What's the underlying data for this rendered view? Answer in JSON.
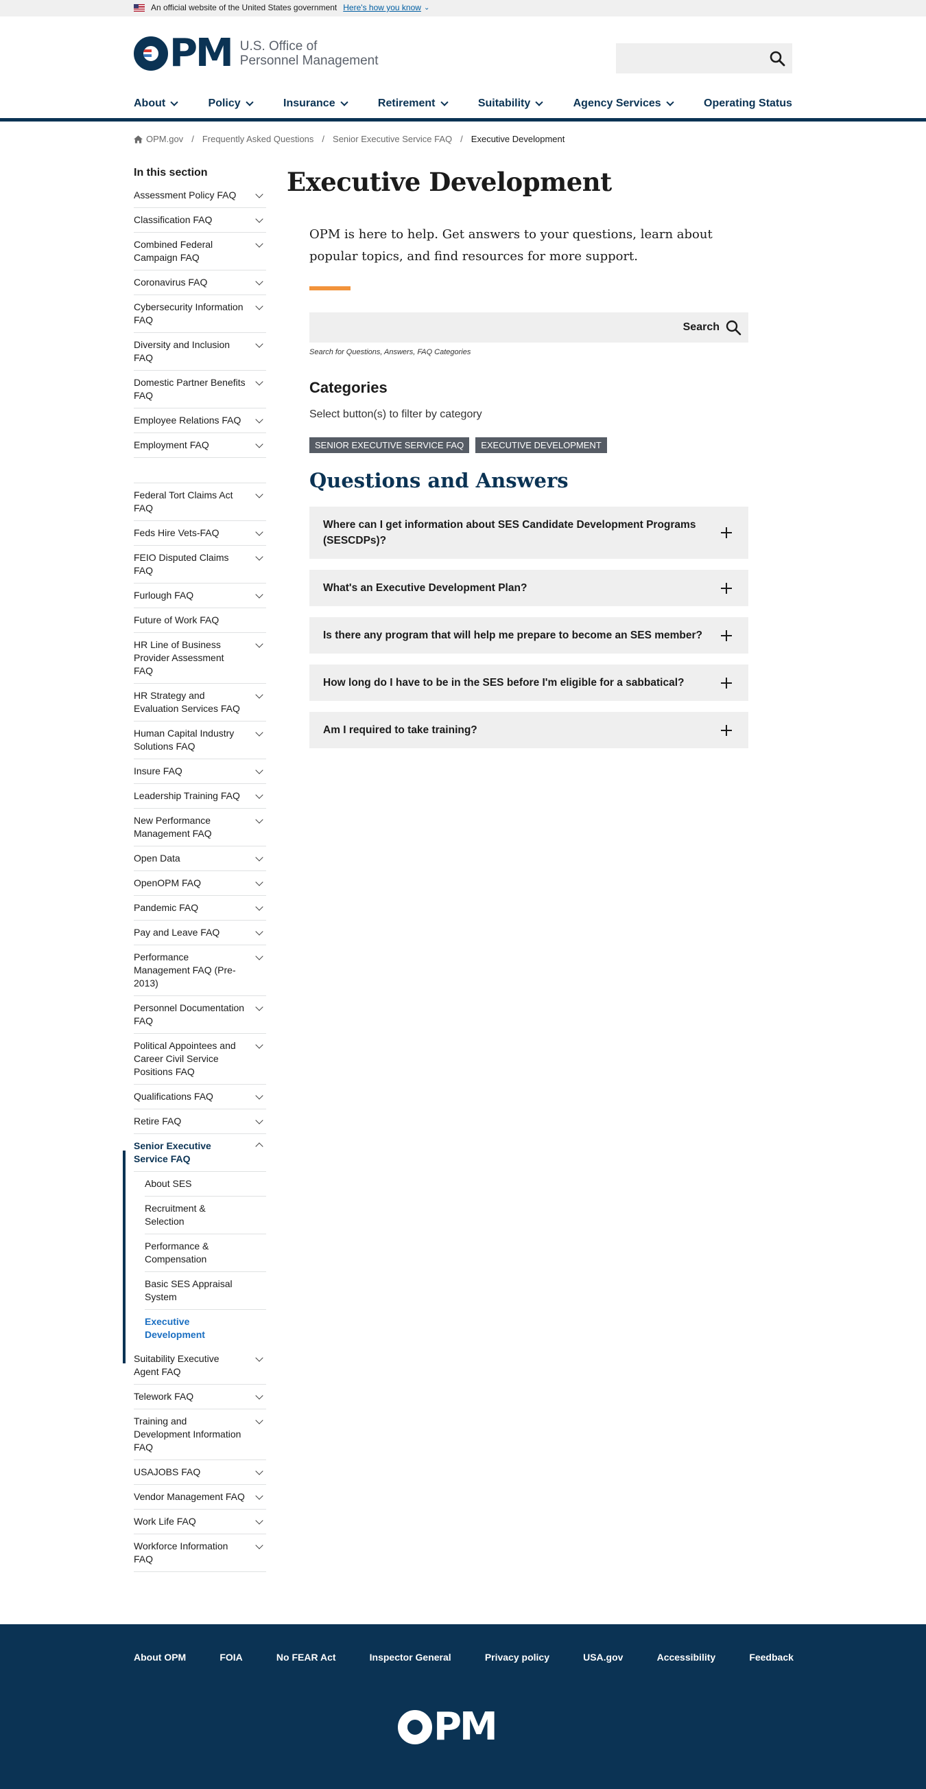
{
  "gov_banner": {
    "text": "An official website of the United States government",
    "link": "Here's how you know"
  },
  "header": {
    "logo_letters": "PM",
    "logo_line1": "U.S. Office of",
    "logo_line2": "Personnel Management",
    "search_placeholder": ""
  },
  "nav": [
    {
      "label": "About",
      "has_menu": true
    },
    {
      "label": "Policy",
      "has_menu": true
    },
    {
      "label": "Insurance",
      "has_menu": true
    },
    {
      "label": "Retirement",
      "has_menu": true
    },
    {
      "label": "Suitability",
      "has_menu": true
    },
    {
      "label": "Agency Services",
      "has_menu": true
    },
    {
      "label": "Operating Status",
      "has_menu": false
    }
  ],
  "breadcrumb": [
    "OPM.gov",
    "Frequently Asked Questions",
    "Senior Executive Service FAQ",
    "Executive Development"
  ],
  "sidebar": {
    "title": "In this section",
    "items": [
      {
        "label": "Assessment Policy FAQ",
        "caret": true
      },
      {
        "label": "Classification FAQ",
        "caret": true
      },
      {
        "label": "Combined Federal Campaign FAQ",
        "caret": true
      },
      {
        "label": "Coronavirus FAQ",
        "caret": true
      },
      {
        "label": "Cybersecurity Information FAQ",
        "caret": true
      },
      {
        "label": "Diversity and Inclusion FAQ",
        "caret": true
      },
      {
        "label": "Domestic Partner Benefits FAQ",
        "caret": true
      },
      {
        "label": "Employee Relations FAQ",
        "caret": true
      },
      {
        "label": "Employment FAQ",
        "caret": true
      },
      {
        "label": "",
        "caret": false
      },
      {
        "label": "Federal Tort Claims Act FAQ",
        "caret": true
      },
      {
        "label": "Feds Hire Vets-FAQ",
        "caret": true
      },
      {
        "label": "FEIO Disputed Claims FAQ",
        "caret": true
      },
      {
        "label": "Furlough FAQ",
        "caret": true
      },
      {
        "label": "Future of Work FAQ",
        "caret": false
      },
      {
        "label": "HR Line of Business Provider Assessment FAQ",
        "caret": true
      },
      {
        "label": "HR Strategy and Evaluation Services FAQ",
        "caret": true
      },
      {
        "label": "Human Capital Industry Solutions FAQ",
        "caret": true
      },
      {
        "label": "Insure FAQ",
        "caret": true
      },
      {
        "label": "Leadership Training FAQ",
        "caret": true
      },
      {
        "label": "New Performance Management FAQ",
        "caret": true
      },
      {
        "label": "Open Data",
        "caret": true
      },
      {
        "label": "OpenOPM FAQ",
        "caret": true
      },
      {
        "label": "Pandemic FAQ",
        "caret": true
      },
      {
        "label": "Pay and Leave FAQ",
        "caret": true
      },
      {
        "label": "Performance Management FAQ (Pre-2013)",
        "caret": true
      },
      {
        "label": "Personnel Documentation FAQ",
        "caret": true
      },
      {
        "label": "Political Appointees and Career Civil Service Positions FAQ",
        "caret": true
      },
      {
        "label": "Qualifications FAQ",
        "caret": true
      },
      {
        "label": "Retire FAQ",
        "caret": true
      },
      {
        "label": "Senior Executive Service FAQ",
        "caret": true,
        "open": true,
        "children": [
          "About SES",
          "Recruitment & Selection",
          "Performance & Compensation",
          "Basic SES Appraisal System",
          "Executive Development"
        ]
      },
      {
        "label": "Suitability Executive Agent FAQ",
        "caret": true
      },
      {
        "label": "Telework FAQ",
        "caret": true
      },
      {
        "label": "Training and Development Information FAQ",
        "caret": true
      },
      {
        "label": "USAJOBS FAQ",
        "caret": true
      },
      {
        "label": "Vendor Management FAQ",
        "caret": true
      },
      {
        "label": "Work Life FAQ",
        "caret": true
      },
      {
        "label": "Workforce Information FAQ",
        "caret": true
      }
    ]
  },
  "main": {
    "title": "Executive Development",
    "intro": "OPM is here to help. Get answers to your questions, learn about popular topics, and find resources for more support.",
    "search_button": "Search",
    "search_hint": "Search for Questions, Answers, FAQ Categories",
    "categories_title": "Categories",
    "categories_sub": "Select button(s) to filter by category",
    "category_tags": [
      "Senior Executive Service FAQ",
      "Executive Development"
    ],
    "qa_title": "Questions and Answers",
    "questions": [
      "Where can I get information about SES Candidate Development Programs (SESCDPs)?",
      "What's an Executive Development Plan?",
      "Is there any program that will help me prepare to become an SES member?",
      "How long do I have to be in the SES before I'm eligible for a sabbatical?",
      "Am I required to take training?"
    ]
  },
  "footer": {
    "links": [
      "About OPM",
      "FOIA",
      "No FEAR Act",
      "Inspector General",
      "Privacy policy",
      "USA.gov",
      "Accessibility",
      "Feedback"
    ],
    "logo_letters": "PM"
  },
  "colors": {
    "navy": "#0b3354",
    "accent": "#f2933b",
    "link": "#005ea2",
    "tag": "#565c65"
  }
}
